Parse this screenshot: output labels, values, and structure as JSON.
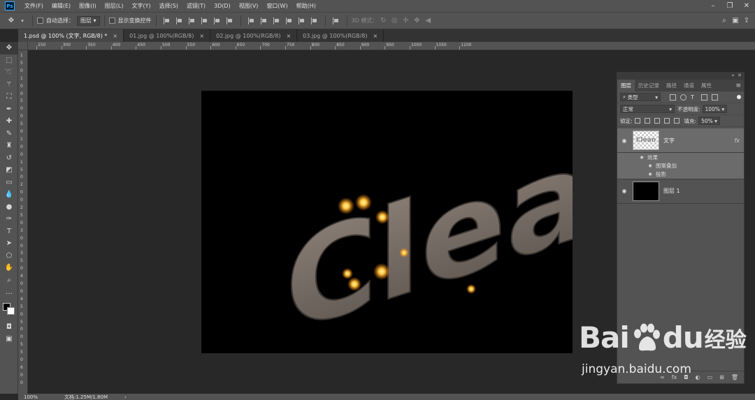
{
  "app": {
    "logo_text": "Ps"
  },
  "menu": [
    "文件(F)",
    "编辑(E)",
    "图像(I)",
    "图层(L)",
    "文字(Y)",
    "选择(S)",
    "滤镜(T)",
    "3D(D)",
    "视图(V)",
    "窗口(W)",
    "帮助(H)"
  ],
  "window_controls": {
    "minimize": "–",
    "restore": "❐",
    "close": "✕"
  },
  "options_bar": {
    "auto_select_label": "自动选择：",
    "auto_select_value": "图层",
    "show_transform_label": "显示变换控件",
    "mode_3d_label": "3D 模式："
  },
  "tabs": [
    {
      "label": "1.psd @ 100% (文字, RGB/8) *",
      "active": true
    },
    {
      "label": "01.jpg @ 100%(RGB/8)",
      "active": false
    },
    {
      "label": "02.jpg @ 100%(RGB/8)",
      "active": false
    },
    {
      "label": "03.jpg @ 100%(RGB/8)",
      "active": false
    }
  ],
  "ruler_top": [
    "250",
    "300",
    "350",
    "400",
    "450",
    "500",
    "550",
    "600",
    "650",
    "700",
    "750",
    "800",
    "850",
    "900",
    "950",
    "1000",
    "1050",
    "1100"
  ],
  "ruler_left": [
    "1",
    "5",
    "0",
    "1",
    "0",
    "0",
    "5",
    "0",
    "0",
    "5",
    "0",
    "1",
    "0",
    "0",
    "1",
    "5",
    "0",
    "2",
    "0",
    "0",
    "2",
    "5",
    "0",
    "3",
    "0",
    "0",
    "3",
    "5",
    "0",
    "4",
    "0",
    "0",
    "4",
    "5",
    "0",
    "5",
    "0",
    "0",
    "5",
    "5",
    "0",
    "6",
    "0",
    "0"
  ],
  "canvas": {
    "text": "Clean"
  },
  "status": {
    "zoom": "100%",
    "doc_info": "文档:1.25M/1.80M",
    "arrow": "›"
  },
  "layers_panel": {
    "tabs": [
      "图层",
      "历史记录",
      "路径",
      "通道",
      "属性"
    ],
    "filter_label": "类型",
    "blend_mode": "正常",
    "opacity_label": "不透明度:",
    "opacity_value": "100%",
    "lock_label": "锁定:",
    "fill_label": "填充:",
    "fill_value": "50%",
    "layers": [
      {
        "name": "文字",
        "fx": "fx",
        "thumb": "transparent",
        "selected": true
      },
      {
        "name": "图层 1",
        "thumb": "black",
        "selected": false
      }
    ],
    "effects_header": "效果",
    "effects": [
      "图案叠加",
      "投影"
    ]
  },
  "watermark": {
    "brand_left": "Bai",
    "brand_right": "du",
    "brand_cn": "经验",
    "url": "jingyan.baidu.com"
  }
}
